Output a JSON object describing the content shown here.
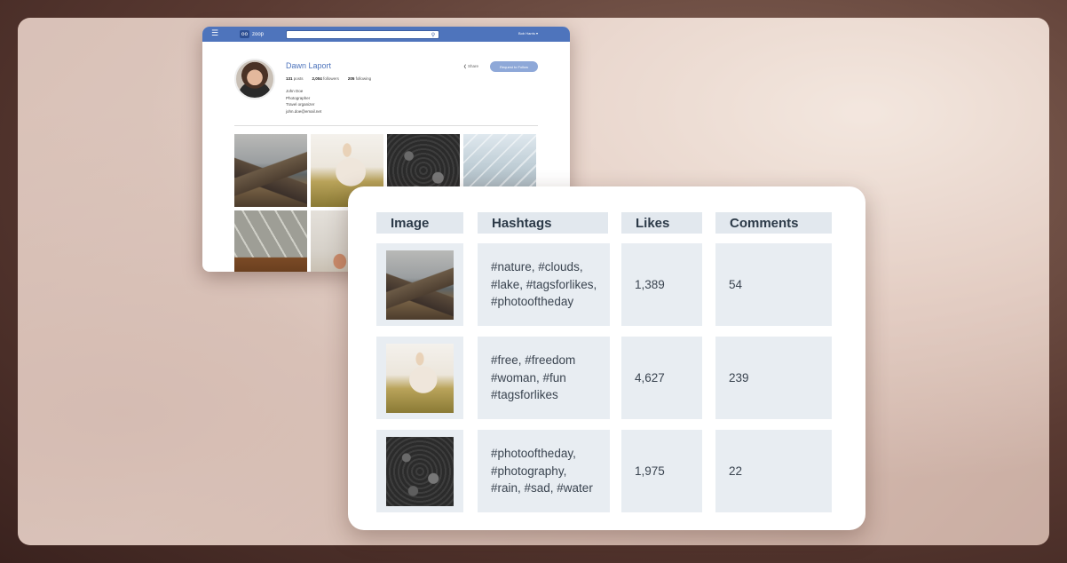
{
  "profile_window": {
    "topbar": {
      "menu_icon": "☰",
      "logo_badge": "oo",
      "logo_text": "zoop",
      "search_placeholder": "",
      "user_menu": "Bob Harris ▾"
    },
    "profile": {
      "name": "Dawn Laport",
      "stats": {
        "posts_count": "131",
        "posts_label": "posts",
        "followers_count": "2,004",
        "followers_label": "followers",
        "following_count": "205",
        "following_label": "following"
      },
      "bio": {
        "name": "John Doe",
        "line1": "Photographer",
        "line2": "Travel organizer",
        "line3": "john.doe@email.net"
      },
      "share_label": "Share",
      "request_button": "Request to Follow"
    },
    "grid_images": [
      "mountain-photo",
      "woman-field-photo",
      "rain-photo",
      "building-photo",
      "triangle-facade-photo",
      "beach-photo"
    ]
  },
  "table": {
    "headers": [
      "Image",
      "Hashtags",
      "Likes",
      "Comments"
    ],
    "rows": [
      {
        "image": "mountain-photo",
        "hashtags": [
          "#nature, #clouds,",
          "#lake, #tagsforlikes,",
          "#photooftheday"
        ],
        "likes": "1,389",
        "comments": "54"
      },
      {
        "image": "woman-field-photo",
        "hashtags": [
          "#free, #freedom",
          "#woman, #fun",
          "#tagsforlikes"
        ],
        "likes": "4,627",
        "comments": "239"
      },
      {
        "image": "rain-photo",
        "hashtags": [
          "#photooftheday,",
          "#photography,",
          "#rain, #sad, #water"
        ],
        "likes": "1,975",
        "comments": "22"
      }
    ]
  }
}
